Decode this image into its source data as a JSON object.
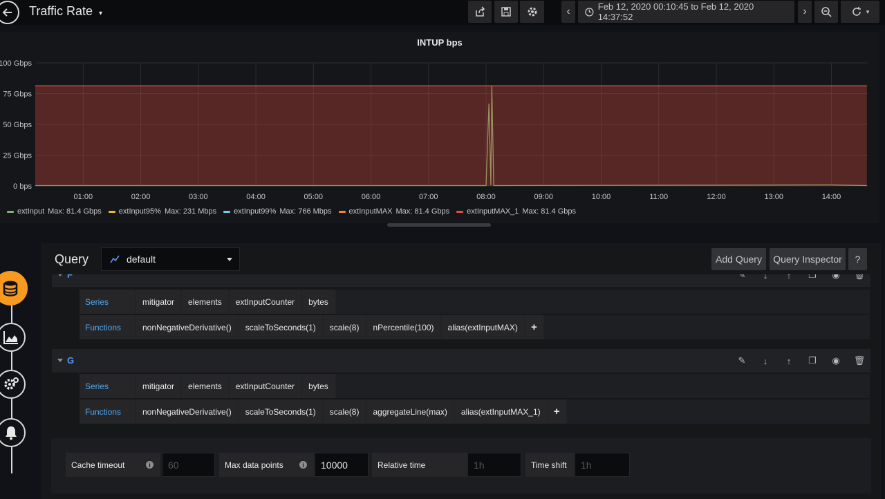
{
  "header": {
    "title": "Traffic Rate",
    "time_range": "Feb 12, 2020 00:10:45 to Feb 12, 2020 14:37:52"
  },
  "panel": {
    "title": "INTUP bps",
    "legend": [
      {
        "name": "extInput",
        "max": "Max: 81.4 Gbps",
        "color": "#7eb26d"
      },
      {
        "name": "extInput95%",
        "max": "Max: 231 Mbps",
        "color": "#eab839"
      },
      {
        "name": "extInput99%",
        "max": "Max: 766 Mbps",
        "color": "#6ed0e0"
      },
      {
        "name": "extInputMAX",
        "max": "Max: 81.4 Gbps",
        "color": "#ef843c"
      },
      {
        "name": "extInputMAX_1",
        "max": "Max: 81.4 Gbps",
        "color": "#e24d42"
      }
    ]
  },
  "chart_data": {
    "type": "line",
    "title": "INTUP bps",
    "y_ticks": [
      "100 Gbps",
      "75 Gbps",
      "50 Gbps",
      "25 Gbps",
      "0 bps"
    ],
    "x_ticks": [
      "01:00",
      "02:00",
      "03:00",
      "04:00",
      "05:00",
      "06:00",
      "07:00",
      "08:00",
      "09:00",
      "10:00",
      "11:00",
      "12:00",
      "13:00",
      "14:00"
    ],
    "ylim": [
      0,
      100
    ],
    "y_unit": "Gbps",
    "grid": true,
    "legend_position": "bottom",
    "series": [
      {
        "name": "extInput",
        "color": "#7eb26d",
        "x": [
          "00:10",
          "08:00",
          "08:03",
          "08:05",
          "08:06",
          "08:08",
          "08:10",
          "14:00",
          "14:37"
        ],
        "values": [
          0.3,
          0.3,
          67,
          0.5,
          81.4,
          0.3,
          0.3,
          0.8,
          0.3
        ]
      },
      {
        "name": "extInputMAX_1",
        "color": "#e24d42",
        "x": [
          "00:10",
          "14:37"
        ],
        "values": [
          81.4,
          81.4
        ],
        "fill": true
      }
    ]
  },
  "editor": {
    "title": "Query",
    "datasource": "default",
    "add_query": "Add Query",
    "query_inspector": "Query Inspector",
    "help": "?",
    "queries": [
      {
        "letter": "F",
        "series_label": "Series",
        "series": [
          "mitigator",
          "elements",
          "extInputCounter",
          "bytes"
        ],
        "functions_label": "Functions",
        "functions": [
          "nonNegativeDerivative()",
          "scaleToSeconds(1)",
          "scale(8)",
          "nPercentile(100)",
          "alias(extInputMAX)"
        ],
        "plus": "+"
      },
      {
        "letter": "G",
        "series_label": "Series",
        "series": [
          "mitigator",
          "elements",
          "extInputCounter",
          "bytes"
        ],
        "functions_label": "Functions",
        "functions": [
          "nonNegativeDerivative()",
          "scaleToSeconds(1)",
          "scale(8)",
          "aggregateLine(max)",
          "alias(extInputMAX_1)"
        ],
        "plus": "+"
      }
    ],
    "options": {
      "cache_timeout_label": "Cache timeout",
      "cache_timeout_placeholder": "60",
      "max_data_points_label": "Max data points",
      "max_data_points_value": "10000",
      "relative_time_label": "Relative time",
      "relative_time_placeholder": "1h",
      "time_shift_label": "Time shift",
      "time_shift_placeholder": "1h",
      "info": "i"
    }
  }
}
